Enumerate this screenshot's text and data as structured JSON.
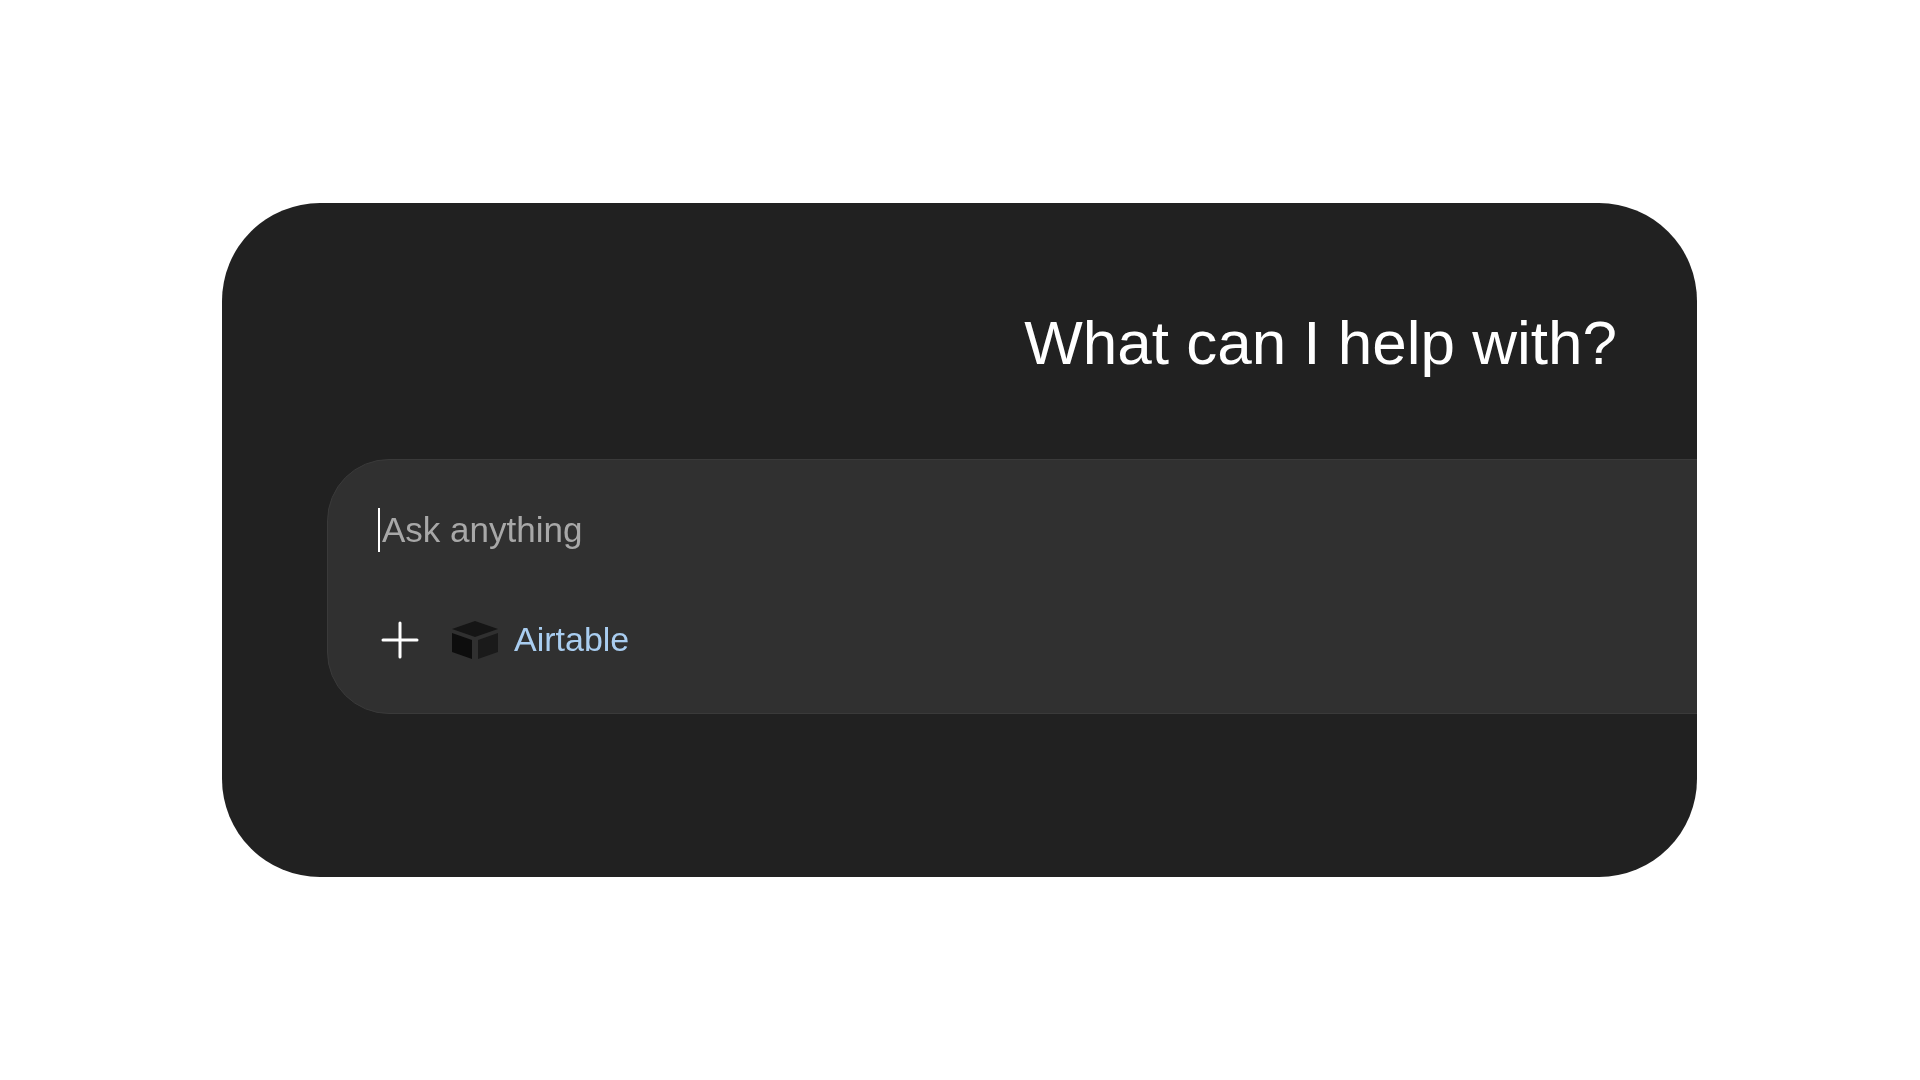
{
  "heading": "What can I help with?",
  "composer": {
    "placeholder": "Ask anything",
    "focused": true,
    "tool_label": "Airtable"
  }
}
